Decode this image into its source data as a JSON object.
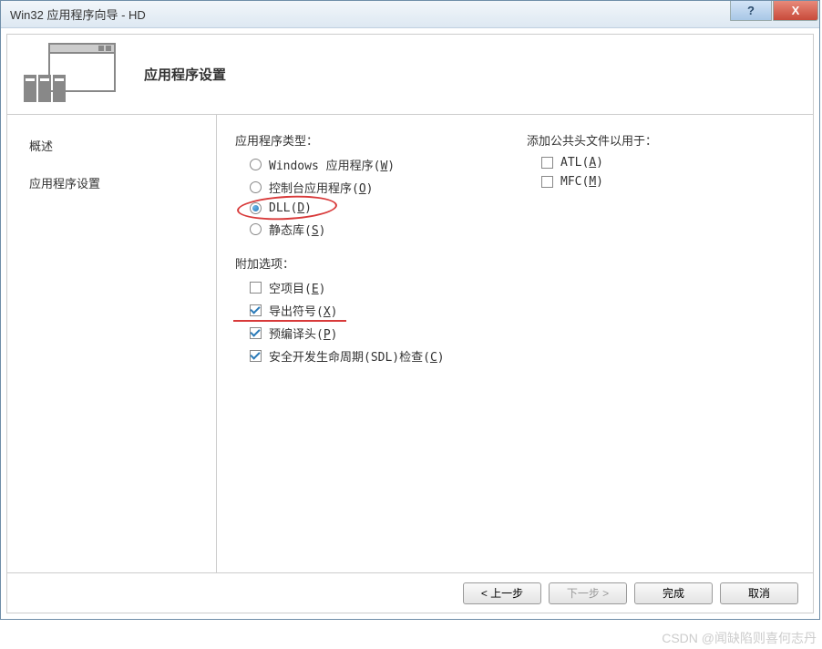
{
  "window": {
    "title": "Win32 应用程序向导 - HD",
    "help_glyph": "?",
    "close_glyph": "X"
  },
  "header": {
    "title": "应用程序设置"
  },
  "sidebar": {
    "items": [
      {
        "label": "概述"
      },
      {
        "label": "应用程序设置"
      }
    ]
  },
  "content": {
    "app_type_title": "应用程序类型：",
    "app_type_options": [
      {
        "label_pre": "Windows 应用程序(",
        "hotkey": "W",
        "label_post": ")",
        "kind": "radio",
        "checked": false
      },
      {
        "label_pre": "控制台应用程序(",
        "hotkey": "O",
        "label_post": ")",
        "kind": "radio",
        "checked": false
      },
      {
        "label_pre": "DLL(",
        "hotkey": "D",
        "label_post": ")",
        "kind": "radio",
        "checked": true,
        "annotated": true
      },
      {
        "label_pre": "静态库(",
        "hotkey": "S",
        "label_post": ")",
        "kind": "radio",
        "checked": false
      }
    ],
    "extra_title": "附加选项：",
    "extra_options": [
      {
        "label_pre": "空项目(",
        "hotkey": "E",
        "label_post": ")",
        "kind": "checkbox",
        "checked": false
      },
      {
        "label_pre": "导出符号(",
        "hotkey": "X",
        "label_post": ")",
        "kind": "checkbox",
        "checked": true,
        "underline": true
      },
      {
        "label_pre": "预编译头(",
        "hotkey": "P",
        "label_post": ")",
        "kind": "checkbox",
        "checked": true
      },
      {
        "label_pre": "安全开发生命周期(SDL)检查(",
        "hotkey": "C",
        "label_post": ")",
        "kind": "checkbox",
        "checked": true
      }
    ],
    "headers_title": "添加公共头文件以用于：",
    "headers_options": [
      {
        "label_pre": "ATL(",
        "hotkey": "A",
        "label_post": ")",
        "kind": "checkbox",
        "checked": false
      },
      {
        "label_pre": "MFC(",
        "hotkey": "M",
        "label_post": ")",
        "kind": "checkbox",
        "checked": false
      }
    ]
  },
  "footer": {
    "prev": "< 上一步",
    "next": "下一步 >",
    "finish": "完成",
    "cancel": "取消"
  },
  "watermark": "CSDN @闻缺陷则喜何志丹"
}
